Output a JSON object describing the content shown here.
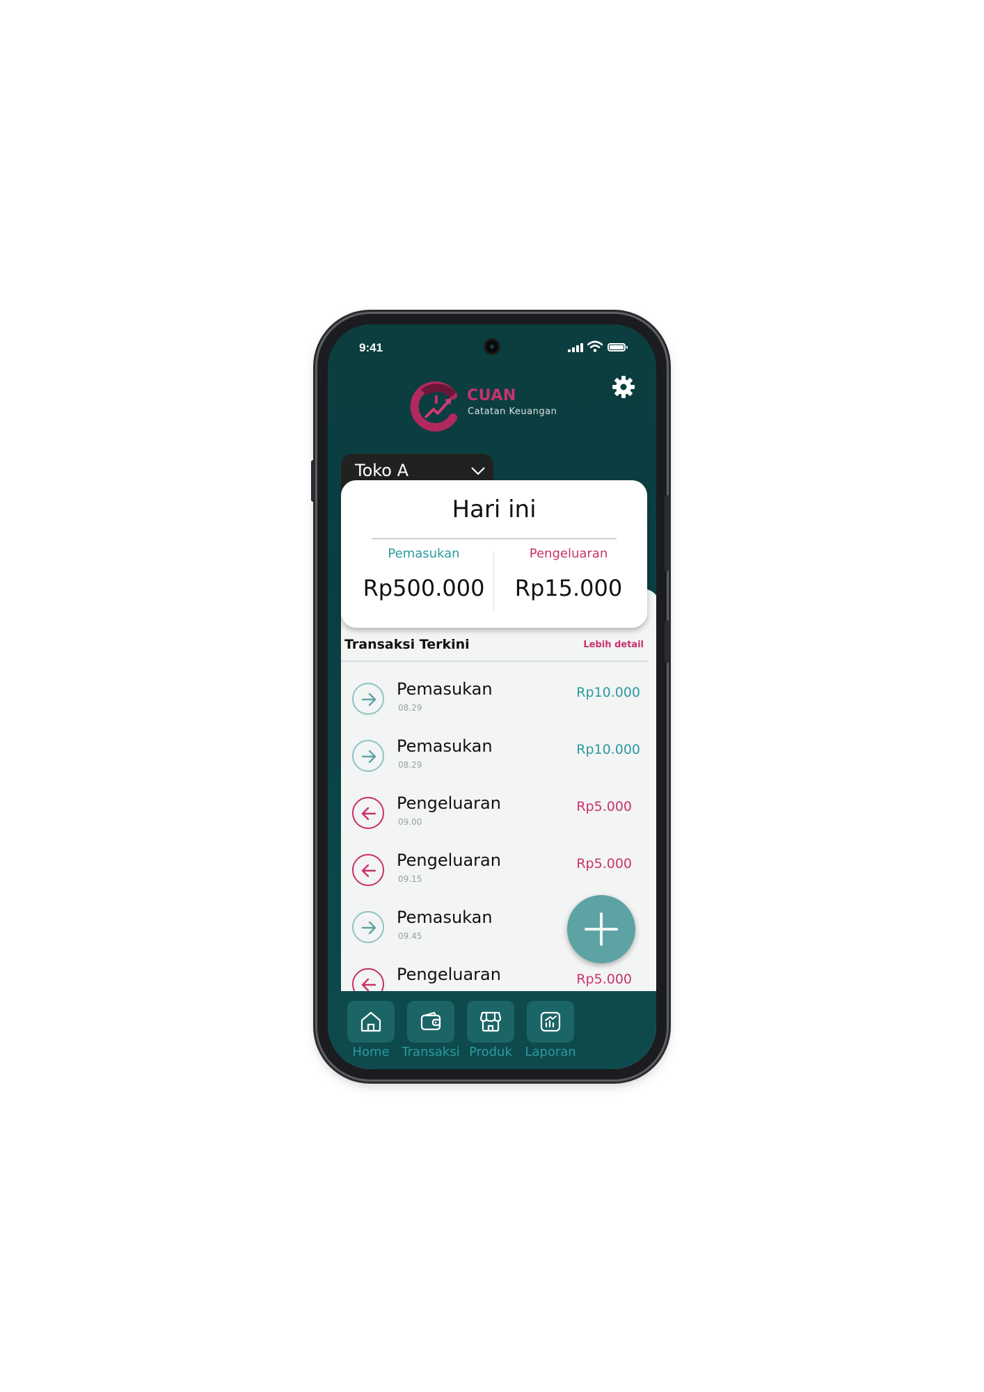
{
  "status_bar": {
    "time": "9:41"
  },
  "brand": {
    "name": "CUAN",
    "tagline": "Catatan Keuangan"
  },
  "store_selector": {
    "selected": "Toko A"
  },
  "summary": {
    "title": "Hari ini",
    "income_label": "Pemasukan",
    "income_amount": "Rp500.000",
    "expense_label": "Pengeluaran",
    "expense_amount": "Rp15.000"
  },
  "recent": {
    "title": "Transaksi Terkini",
    "more_label": "Lebih detail",
    "items": [
      {
        "type": "in",
        "name": "Pemasukan",
        "time": "08.29",
        "amount": "Rp10.000"
      },
      {
        "type": "in",
        "name": "Pemasukan",
        "time": "08.29",
        "amount": "Rp10.000"
      },
      {
        "type": "out",
        "name": "Pengeluaran",
        "time": "09.00",
        "amount": "Rp5.000"
      },
      {
        "type": "out",
        "name": "Pengeluaran",
        "time": "09.15",
        "amount": "Rp5.000"
      },
      {
        "type": "in",
        "name": "Pemasukan",
        "time": "09.45",
        "amount": ""
      },
      {
        "type": "out",
        "name": "Pengeluaran",
        "time": "",
        "amount": "Rp5.000"
      }
    ]
  },
  "nav": [
    {
      "label": "Home",
      "icon": "home-icon"
    },
    {
      "label": "Transaksi",
      "icon": "wallet-icon"
    },
    {
      "label": "Produk",
      "icon": "store-icon"
    },
    {
      "label": "Laporan",
      "icon": "report-icon"
    }
  ],
  "colors": {
    "teal": "#2a9a9f",
    "pink": "#c8326c",
    "header": "#0c3d3f",
    "fab": "#5ea3a4"
  }
}
